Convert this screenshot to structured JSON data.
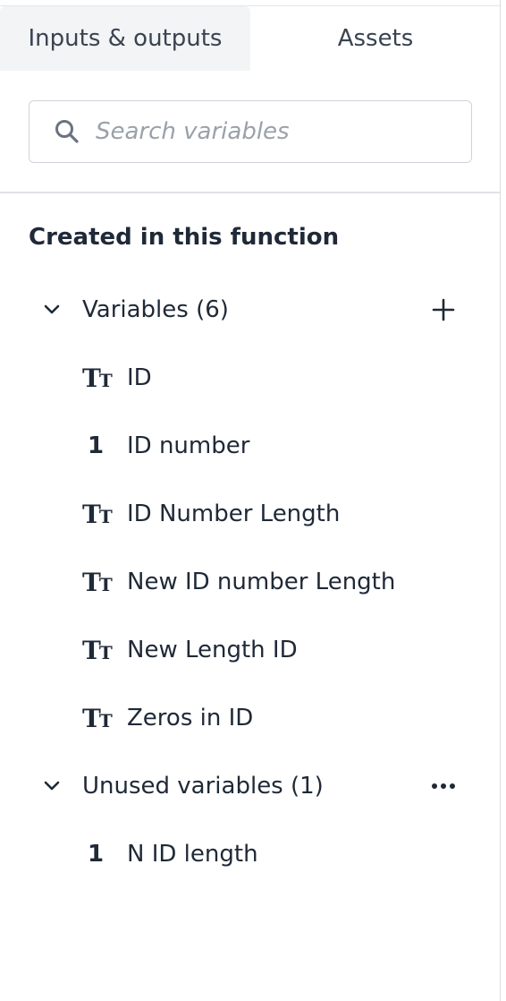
{
  "tabs": [
    {
      "label": "Inputs & outputs",
      "active": true
    },
    {
      "label": "Assets",
      "active": false
    }
  ],
  "search": {
    "placeholder": "Search variables",
    "value": ""
  },
  "section": {
    "title": "Created in this function"
  },
  "groups": {
    "variables": {
      "label": "Variables (6)",
      "action_icon": "plus-icon",
      "items": [
        {
          "type": "text",
          "icon": "text-type-icon",
          "name": "ID"
        },
        {
          "type": "number",
          "icon": "number-type-icon",
          "icon_glyph": "1",
          "name": "ID number"
        },
        {
          "type": "text",
          "icon": "text-type-icon",
          "name": "ID Number Length"
        },
        {
          "type": "text",
          "icon": "text-type-icon",
          "name": "New ID number Length"
        },
        {
          "type": "text",
          "icon": "text-type-icon",
          "name": "New Length ID"
        },
        {
          "type": "text",
          "icon": "text-type-icon",
          "name": "Zeros in ID"
        }
      ]
    },
    "unused": {
      "label": "Unused variables (1)",
      "action_icon": "more-icon",
      "items": [
        {
          "type": "number",
          "icon": "number-type-icon",
          "icon_glyph": "1",
          "name": "N ID length"
        }
      ]
    }
  },
  "colors": {
    "text": "#1f2937",
    "muted": "#9aa1a9",
    "active_tab_bg": "#f2f4f6",
    "border": "#cfd4da"
  }
}
